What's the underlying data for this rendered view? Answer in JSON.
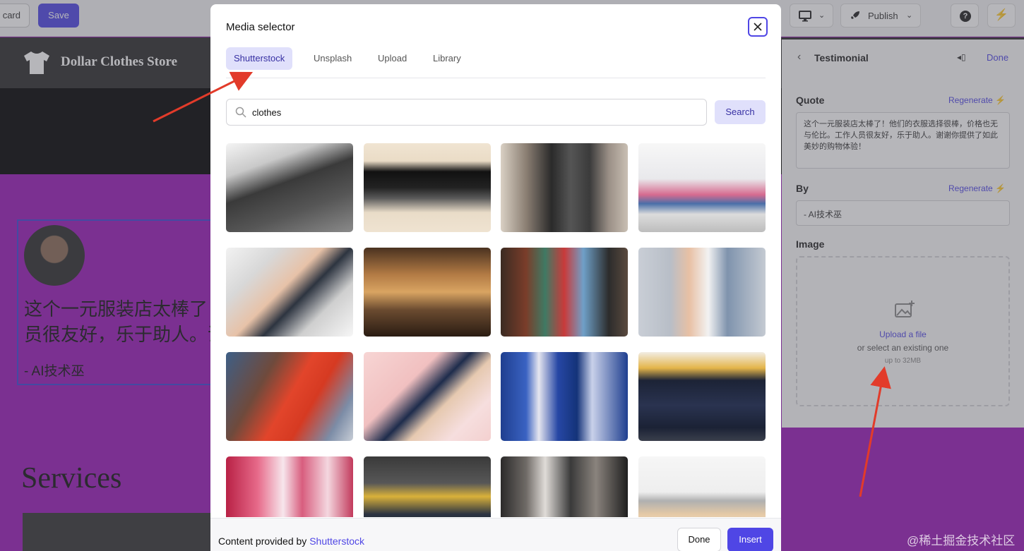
{
  "toolbar": {
    "discard_label": "card",
    "save_label": "Save",
    "publish_label": "Publish"
  },
  "site": {
    "brand": "Dollar Clothes Store",
    "testimonial_quote": "这个一元服装店太棒了！他们的衣服选择很棒，价格也无与伦比。工作人员很友好，乐于助人。谢谢你提供了如此美妙的购物体验！",
    "testimonial_line1": "这个一元服装店太棒了！他们的衣服选择很棒，价格也无与伦比。工作人",
    "testimonial_line2": "员很友好，乐于助人。谢谢你提供了如此美妙的购物体验！",
    "testimonial_by": "- AI技术巫",
    "services_title": "Services",
    "background_color": "#9a19b8"
  },
  "panel": {
    "title": "Testimonial",
    "done_label": "Done",
    "quote_label": "Quote",
    "quote_regenerate": "Regenerate",
    "quote_value": "这个一元服装店太棒了！他们的衣服选择很棒，价格也无与伦比。工作人员很友好，乐于助人。谢谢你提供了如此美妙的购物体验！",
    "by_label": "By",
    "by_regenerate": "Regenerate",
    "by_value": "- AI技术巫",
    "image_label": "Image",
    "upload_link": "Upload a file",
    "upload_hint": "or select an existing one",
    "upload_limit": "up to 32MB"
  },
  "modal": {
    "title": "Media selector",
    "tabs": [
      {
        "label": "Shutterstock",
        "active": true
      },
      {
        "label": "Unsplash",
        "active": false
      },
      {
        "label": "Upload",
        "active": false
      },
      {
        "label": "Library",
        "active": false
      }
    ],
    "search": {
      "value": "clothes",
      "button_label": "Search"
    },
    "results": [
      {
        "name": "folded-dark-shirts-on-rack",
        "bg": "linear-gradient(160deg,#f4f4f4 0%,#c9c9c9 25%,#3a3a3a 45%,#565656 70%,#8a8a8a 100%)"
      },
      {
        "name": "black-cap-on-folded-clothes",
        "bg": "linear-gradient(180deg,#f0e4d2 0%,#eadcc6 20%,#111 32%,#222 50%,#5a5a5a 62%,#e9dcc8 78%,#efe3d1 100%)"
      },
      {
        "name": "clothing-rack-sweaters",
        "bg": "linear-gradient(90deg,#d9d0c4 0%,#8b7f73 20%,#2a2a2a 40%,#555 55%,#3b3b3b 70%,#9a8f86 85%,#c9bfb3 100%)"
      },
      {
        "name": "clothing-store-interior",
        "bg": "linear-gradient(180deg,#f7f7f7 0%,#e9e9ec 40%,#d66b8f 58%,#4a6fa8 68%,#dcdcdc 80%,#bdbdbd 100%)"
      },
      {
        "name": "sewing-machine-hands",
        "bg": "linear-gradient(135deg,#f2f2f2 0%,#d8d8d8 25%,#e7c2a8 45%,#2d3440 58%,#cfcfcf 75%,#f6f6f6 100%)"
      },
      {
        "name": "boutique-wooden-shelves",
        "bg": "linear-gradient(180deg,#4a3220 0%,#b27a44 30%,#d9a462 50%,#6b4b30 70%,#2a1c12 100%)"
      },
      {
        "name": "colored-shirts-on-hangers",
        "bg": "linear-gradient(90deg,#3b2b22 0%,#7a3d2a 20%,#3f7a64 35%,#c93a3a 50%,#6fa0c8 65%,#2c2c2c 85%,#5a4a3e 100%)"
      },
      {
        "name": "couple-in-jeans",
        "bg": "linear-gradient(90deg,#c9ced6 0%,#b8bec7 25%,#e8c0a4 40%,#f2f2f2 55%,#7f93ad 70%,#c4cad2 100%)"
      },
      {
        "name": "woman-holding-red-shirt",
        "bg": "linear-gradient(120deg,#3e5f86 0%,#6f4a3c 30%,#e2452b 50%,#d63a22 65%,#7c8ca6 85%,#c7cdd6 100%)"
      },
      {
        "name": "pink-flatlay-handbag",
        "bg": "linear-gradient(135deg,#f7d5d4 0%,#f1c0c0 35%,#1e2c4c 50%,#e6c9b0 62%,#f6dede 80%,#f3d0cf 100%)"
      },
      {
        "name": "blue-floral-dresses",
        "bg": "linear-gradient(90deg,#1f3f8f 0%,#3a62c2 20%,#e6e6ef 30%,#2747a5 45%,#143379 60%,#c9d1ea 72%,#1f3f8f 100%)"
      },
      {
        "name": "navy-jackets-on-rack",
        "bg": "linear-gradient(180deg,#f2ede4 0%,#e4b54a 18%,#1c2336 32%,#2a3350 60%,#1b2235 85%,#3a3f4c 100%)"
      },
      {
        "name": "pink-dresses-on-rack",
        "bg": "linear-gradient(90deg,#b82145 0%,#e76a8a 25%,#f7e6ec 45%,#d85d7e 60%,#f4d7df 80%,#c23a5c 100%)"
      },
      {
        "name": "hangers-yellow-jacket",
        "bg": "linear-gradient(180deg,#3a3a3a 0%,#575757 30%,#d9b13a 45%,#2b3342 65%,#1d2430 100%)"
      },
      {
        "name": "dresses-in-closet",
        "bg": "linear-gradient(90deg,#2b2a2a 0%,#6f6a66 20%,#e0dcd8 35%,#3a3a3a 55%,#8a837d 75%,#1f1f1f 100%)"
      },
      {
        "name": "empty-rack-white-hangers",
        "bg": "linear-gradient(180deg,#f6f6f6 0%,#eeeeee 40%,#b0b0b0 50%,#e5c9a6 65%,#f2f2f2 100%)"
      }
    ],
    "footer_credit": "Content provided by ",
    "footer_source": "Shutterstock",
    "done_label": "Done",
    "insert_label": "Insert"
  },
  "watermark": "@稀土掘金技术社区",
  "colors": {
    "accent": "#4f46e5",
    "annotation_arrow": "#e23b2a"
  }
}
